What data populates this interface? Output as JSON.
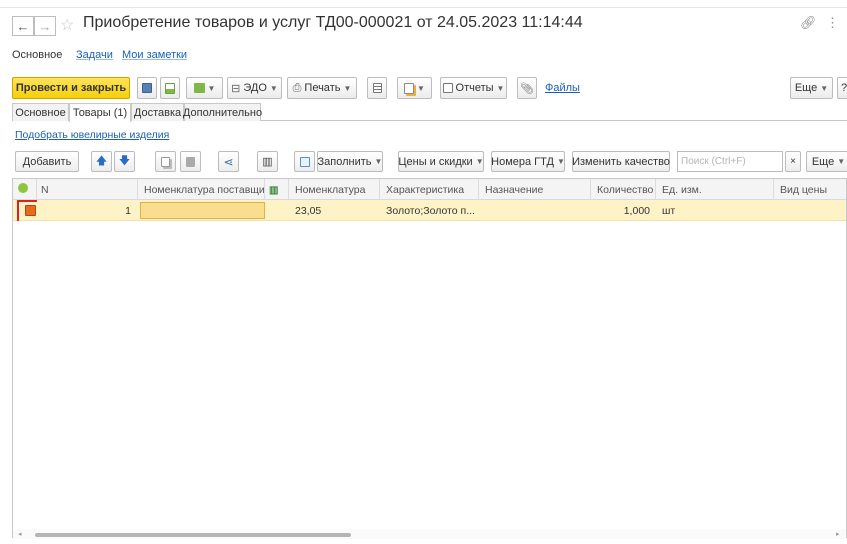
{
  "window": {
    "title": "Приобретение товаров и услуг ТД00-000021 от 24.05.2023 11:14:44"
  },
  "sections": [
    "Основное",
    "Задачи",
    "Мои заметки"
  ],
  "toolbar": {
    "post_close": "Провести и закрыть",
    "edo": "ЭДО",
    "print": "Печать",
    "reports": "Отчеты",
    "files": "Файлы",
    "more": "Еще",
    "help": "?"
  },
  "tabs": [
    "Основное",
    "Товары (1)",
    "Доставка",
    "Дополнительно"
  ],
  "jewel_link": "Подобрать ювелирные изделия",
  "grid_toolbar": {
    "add": "Добавить",
    "fill": "Заполнить",
    "prices": "Цены и скидки",
    "gtd": "Номера ГТД",
    "quality": "Изменить качество",
    "search_placeholder": "Поиск (Ctrl+F)",
    "clear": "×",
    "more": "Еще"
  },
  "grid": {
    "columns": [
      "N",
      "Номенклатура поставщика",
      "Номенклатура",
      "Характеристика",
      "Назначение",
      "Количество",
      "Ед. изм.",
      "Вид цены"
    ],
    "rows": [
      {
        "n": "1",
        "supplier_item": "",
        "item": "23,05",
        "characteristic": "Золото;Золото п...",
        "purpose": "",
        "qty": "1,000",
        "unit": "шт",
        "price_type": ""
      }
    ]
  },
  "colors": {
    "accent_yellow": "#f5cf0a",
    "row_highlight": "#fdf3c7",
    "link_blue": "#1a5fb4",
    "selection_red": "#e02020"
  }
}
